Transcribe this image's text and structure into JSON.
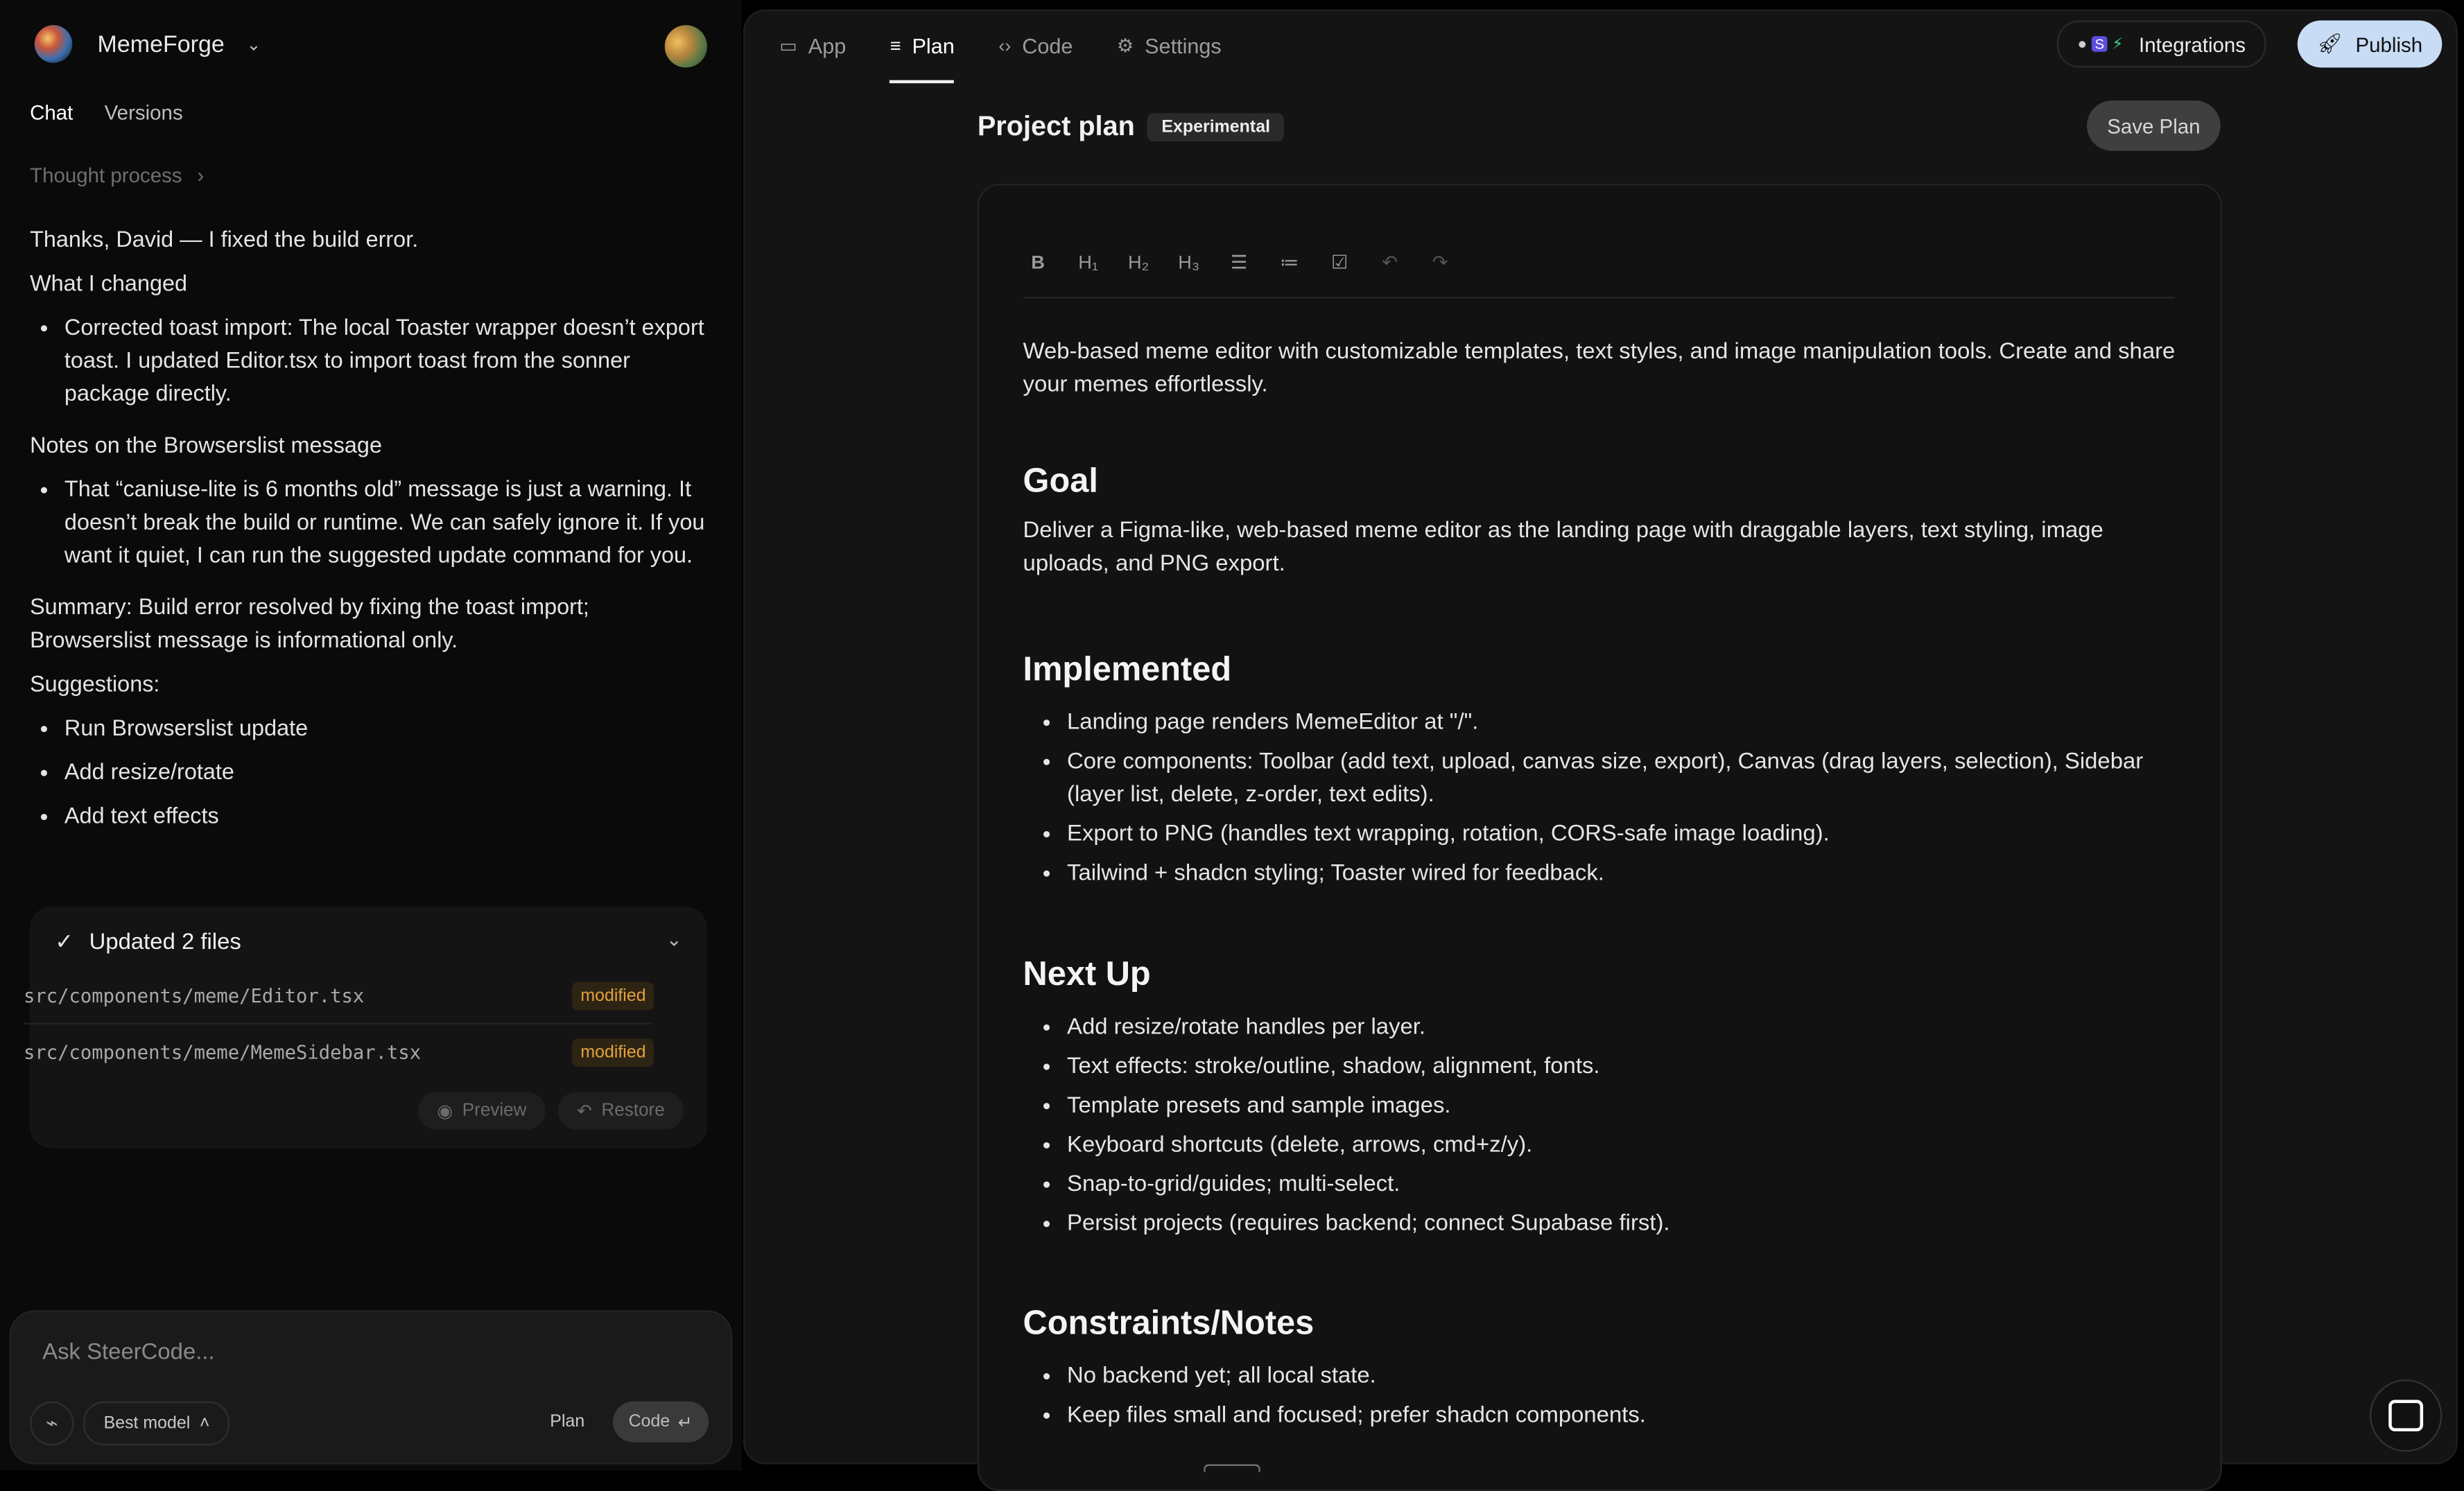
{
  "sidebar": {
    "app_name": "MemeForge",
    "tabs": [
      "Chat",
      "Versions"
    ],
    "thought_label": "Thought process",
    "message": {
      "intro": "Thanks, David — I fixed the build error.",
      "changed_heading": "What I changed",
      "changed_items": [
        "Corrected toast import: The local Toaster wrapper doesn’t export toast. I updated Editor.tsx to import toast from the sonner package directly."
      ],
      "notes_heading": "Notes on the Browserslist message",
      "notes_items": [
        "That “caniuse-lite is 6 months old” message is just a warning. It doesn’t break the build or runtime. We can safely ignore it. If you want it quiet, I can run the suggested update command for you."
      ],
      "summary": "Summary: Build error resolved by fixing the toast import; Browserslist message is informational only.",
      "suggestions_heading": "Suggestions:",
      "suggestions": [
        "Run Browserslist update",
        "Add resize/rotate",
        "Add text effects"
      ]
    },
    "files_card": {
      "title": "Updated 2 files",
      "files": [
        {
          "path": "src/components/meme/Editor.tsx",
          "status": "modified"
        },
        {
          "path": "src/components/meme/MemeSidebar.tsx",
          "status": "modified"
        }
      ],
      "preview_label": "Preview",
      "restore_label": "Restore"
    },
    "composer": {
      "placeholder": "Ask SteerCode...",
      "model_label": "Best model",
      "plan_label": "Plan",
      "code_label": "Code"
    }
  },
  "topnav": {
    "tabs": [
      {
        "label": "App",
        "icon": "laptop-icon"
      },
      {
        "label": "Plan",
        "icon": "plan-icon"
      },
      {
        "label": "Code",
        "icon": "code-icon"
      },
      {
        "label": "Settings",
        "icon": "gear-icon"
      }
    ],
    "active_tab": "Plan",
    "integrations_label": "Integrations",
    "publish_label": "Publish"
  },
  "plan": {
    "title": "Project plan",
    "badge": "Experimental",
    "save_label": "Save Plan",
    "toolbar": [
      "bold-icon",
      "h1-icon",
      "h2-icon",
      "h3-icon",
      "bullet-list-icon",
      "numbered-list-icon",
      "checklist-icon",
      "undo-icon",
      "redo-icon"
    ],
    "toolbar_glyphs": {
      "h1": "H₁",
      "h2": "H₂",
      "h3": "H₃"
    },
    "intro": "Web-based meme editor with customizable templates, text styles, and image manipulation tools. Create and share your memes effortlessly.",
    "sections": [
      {
        "heading": "Goal",
        "text": "Deliver a Figma-like, web-based meme editor as the landing page with draggable layers, text styling, image uploads, and PNG export."
      },
      {
        "heading": "Implemented",
        "items": [
          "Landing page renders MemeEditor at \"/\".",
          "Core components: Toolbar (add text, upload, canvas size, export), Canvas (drag layers, selection), Sidebar (layer list, delete, z-order, text edits).",
          "Export to PNG (handles text wrapping, rotation, CORS-safe image loading).",
          "Tailwind + shadcn styling; Toaster wired for feedback."
        ]
      },
      {
        "heading": "Next Up",
        "items": [
          "Add resize/rotate handles per layer.",
          "Text effects: stroke/outline, shadow, alignment, fonts.",
          "Template presets and sample images.",
          "Keyboard shortcuts (delete, arrows, cmd+z/y).",
          "Snap-to-grid/guides; multi-select.",
          "Persist projects (requires backend; connect Supabase first)."
        ]
      },
      {
        "heading": "Constraints/Notes",
        "items": [
          "No backend yet; all local state.",
          "Keep files small and focused; prefer shadcn components."
        ]
      }
    ]
  }
}
